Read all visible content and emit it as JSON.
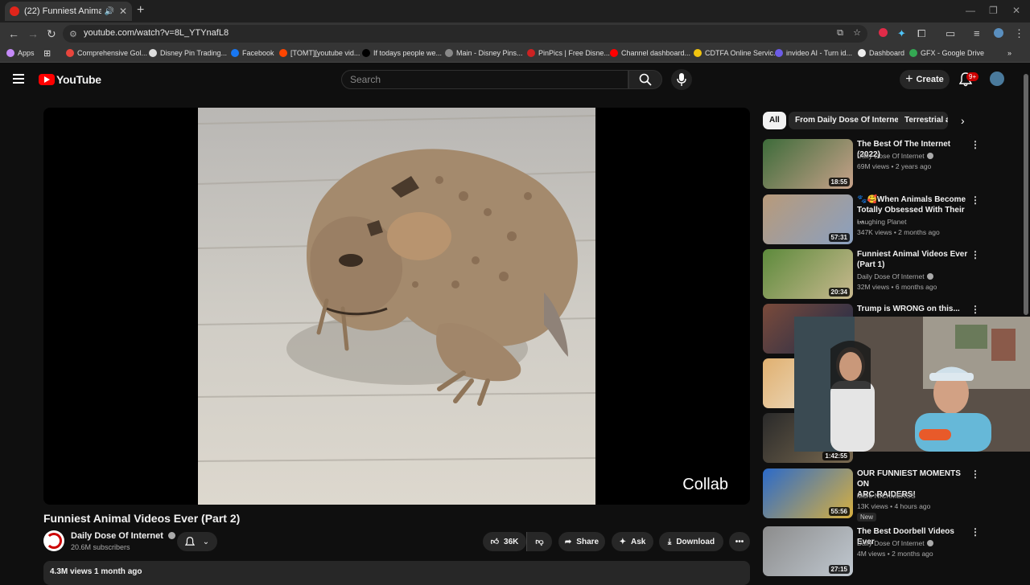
{
  "browser": {
    "tab_title": "(22) Funniest Animal Videos Ever",
    "url": "youtube.com/watch?v=8L_YTYnafL8",
    "bookmarks": [
      {
        "label": "Apps",
        "color": "#c58af9"
      },
      {
        "label": "Comprehensive Gol...",
        "color": "#e8453c"
      },
      {
        "label": "Disney Pin Trading...",
        "color": "#dddddd"
      },
      {
        "label": "Facebook",
        "color": "#1877f2"
      },
      {
        "label": "[TOMT][youtube vid...",
        "color": "#ff4500"
      },
      {
        "label": "If todays people we...",
        "color": "#000000"
      },
      {
        "label": "Main - Disney Pins...",
        "color": "#888888"
      },
      {
        "label": "PinPics | Free Disne...",
        "color": "#cc2222"
      },
      {
        "label": "Channel dashboard...",
        "color": "#ff0000"
      },
      {
        "label": "CDTFA Online Servic...",
        "color": "#f1c40f"
      },
      {
        "label": "invideo AI - Turn id...",
        "color": "#6c5ce7"
      },
      {
        "label": "Dashboard",
        "color": "#eeeeee"
      },
      {
        "label": "GFX - Google Drive",
        "color": "#34a853"
      }
    ]
  },
  "youtube": {
    "logo": "YouTube",
    "search_placeholder": "Search",
    "create_label": "Create",
    "notif_count": "9+"
  },
  "video": {
    "overlay_text": "Collab",
    "title": "Funniest Animal Videos Ever (Part 2)",
    "channel": "Daily Dose Of Internet",
    "subscribers": "20.6M subscribers",
    "likes": "36K",
    "share": "Share",
    "ask": "Ask",
    "download": "Download",
    "stats": "4.3M views  1 month ago"
  },
  "chips": [
    "All",
    "From Daily Dose Of Internet",
    "Terrestrial an"
  ],
  "recommendations": [
    {
      "title_lines": [
        "The Best Of The Internet (2022)"
      ],
      "channel": "Daily Dose Of Internet",
      "verified": true,
      "meta": "69M views • 2 years ago",
      "duration": "18:55",
      "thumb_colors": [
        "#3d6b3a",
        "#c8a28a"
      ]
    },
    {
      "title_lines": [
        "🐾🥰When Animals Become",
        "Totally Obsessed With Their ..."
      ],
      "channel": "Laughing Planet",
      "verified": false,
      "meta": "347K views • 2 months ago",
      "duration": "57:31",
      "thumb_colors": [
        "#b89a7a",
        "#8aa0c0"
      ]
    },
    {
      "title_lines": [
        "Funniest Animal Videos Ever",
        "(Part 1)"
      ],
      "channel": "Daily Dose Of Internet",
      "verified": true,
      "meta": "32M views • 6 months ago",
      "duration": "20:34",
      "thumb_colors": [
        "#5d8a3c",
        "#c9b98f"
      ]
    },
    {
      "title_lines": [
        "Trump is WRONG on this..."
      ],
      "channel": "",
      "verified": false,
      "meta": "",
      "duration": "",
      "thumb_colors": [
        "#7a4a3a",
        "#1c2a4a"
      ]
    },
    {
      "title_lines": [
        ""
      ],
      "channel": "",
      "verified": false,
      "meta": "",
      "duration": "",
      "thumb_colors": [
        "#e0b070",
        "#f0e8d8"
      ]
    },
    {
      "title_lines": [
        ""
      ],
      "channel": "Free with ads  PG",
      "verified": false,
      "meta": "",
      "duration": "1:42:55",
      "thumb_colors": [
        "#2a2a2a",
        "#7a6a50"
      ]
    },
    {
      "title_lines": [
        "OUR FUNNIEST MOMENTS ON",
        "ARC RAIDERS!"
      ],
      "channel": "More NICKMERCS",
      "verified": false,
      "meta": "13K views • 4 hours ago",
      "duration": "55:56",
      "thumb_colors": [
        "#2b6ac9",
        "#d8b040"
      ],
      "badge": "New"
    },
    {
      "title_lines": [
        "The Best Doorbell Videos Ever"
      ],
      "channel": "Daily Dose Of Internet",
      "verified": true,
      "meta": "4M views • 2 months ago",
      "duration": "27:15",
      "thumb_colors": [
        "#8c8c8c",
        "#c0c8d0"
      ]
    }
  ]
}
